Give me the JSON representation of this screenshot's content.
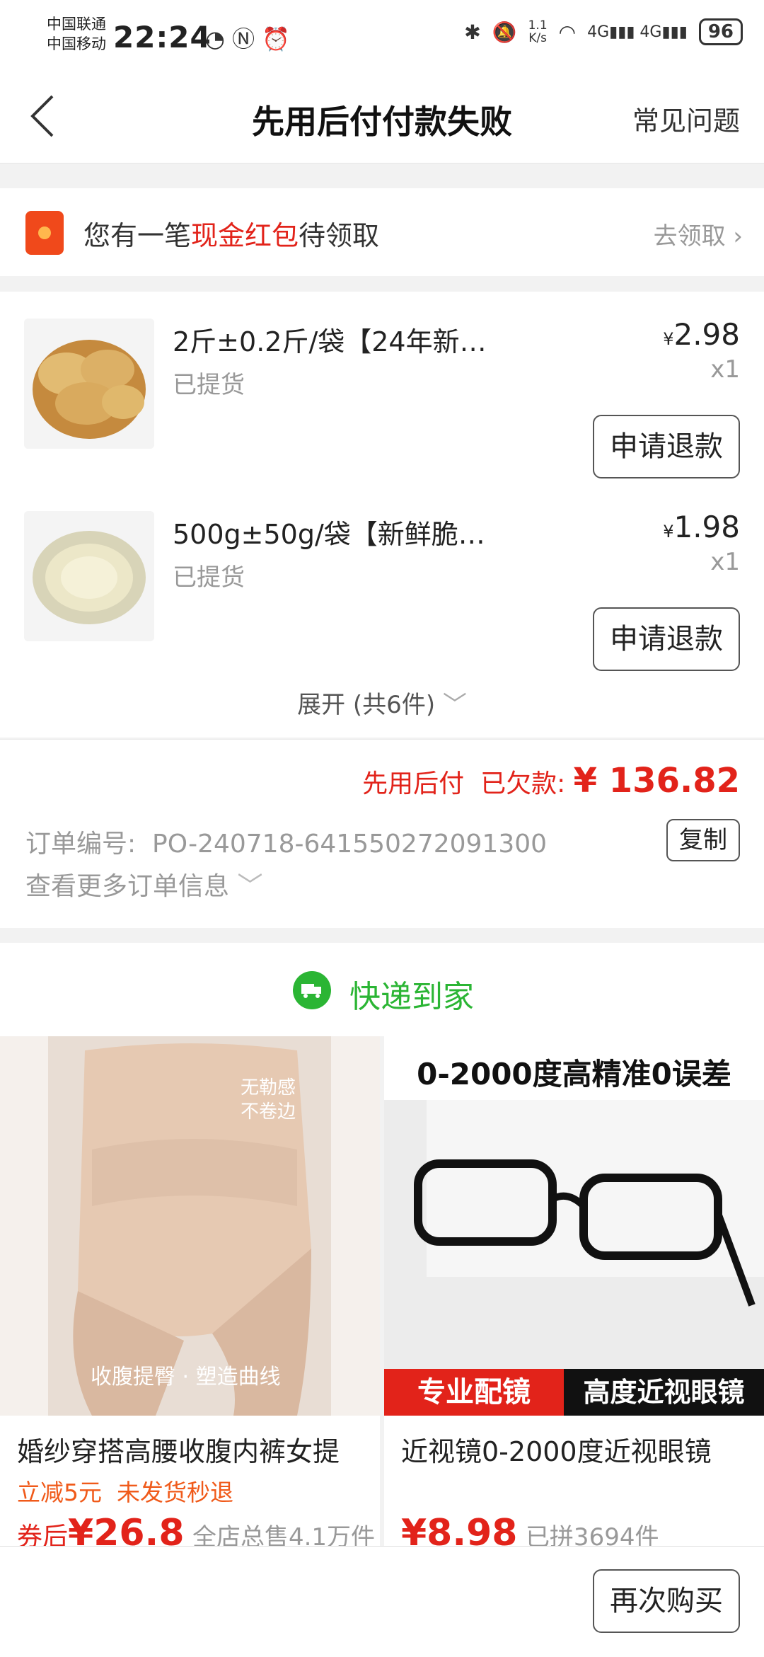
{
  "status_bar": {
    "carrier1": "中国联通",
    "carrier2": "中国移动",
    "time": "22:24",
    "net_speed": "1.1\nK/s",
    "battery": "96"
  },
  "header": {
    "title": "先用后付付款失败",
    "faq": "常见问题"
  },
  "redpacket": {
    "text_prefix": "您有一笔",
    "text_highlight": "现金红包",
    "text_suffix": "待领取",
    "action": "去领取"
  },
  "goods": [
    {
      "name": "2斤±0.2斤/袋【24年新…",
      "state": "已提货",
      "currency": "¥",
      "price": "2.98",
      "qty": "x1",
      "button": "申请退款"
    },
    {
      "name": "500g±50g/袋【新鲜脆…",
      "state": "已提货",
      "currency": "¥",
      "price": "1.98",
      "qty": "x1",
      "button": "申请退款"
    }
  ],
  "expand": "展开 (共6件)",
  "order": {
    "pay_label": "先用后付",
    "owed_label": "已欠款:",
    "owed_amount": "¥ 136.82",
    "order_no_label": "订单编号:",
    "order_no": "PO-240718-641550272091300",
    "copy_button": "复制",
    "more_info": "查看更多订单信息"
  },
  "express": {
    "label": "快递到家"
  },
  "products": [
    {
      "image_text": [
        "无勒感",
        "不卷边",
        "收腹提臀 · 塑造曲线"
      ],
      "name": "婚纱穿搭高腰收腹内裤女提",
      "tags": "立减5元  未发货秒退",
      "price_prefix": "券后",
      "price": "¥26.8",
      "sold": "全店总售4.1万件"
    },
    {
      "image_text": [
        "0-2000度高精准0误差",
        "专业配镜",
        "高度近视眼镜"
      ],
      "name": "近视镜0-2000度近视眼镜",
      "tags": "",
      "price_prefix": "",
      "price": "¥8.98",
      "sold": "已拼3694件"
    }
  ],
  "bottom": {
    "rebuy": "再次购买"
  },
  "colors": {
    "accent_red": "#e2231a",
    "express_green": "#2bb534",
    "tag_orange": "#f05a1a"
  }
}
